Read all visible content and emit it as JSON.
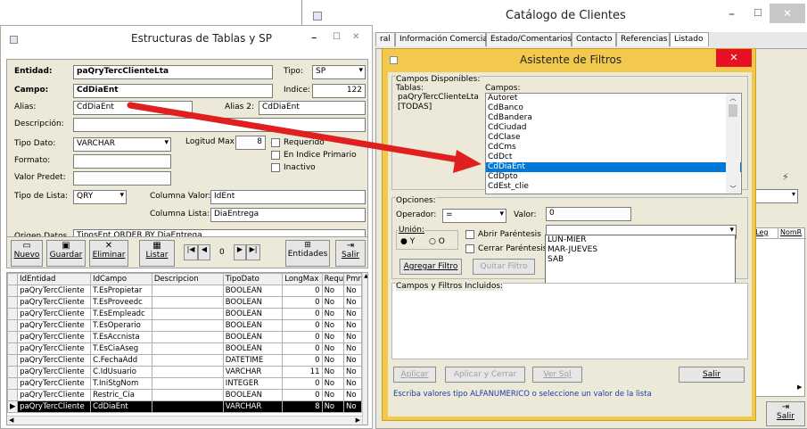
{
  "catalog": {
    "title": "Catálogo de Clientes",
    "tabs": [
      "ral",
      "Información Comercial",
      "Estado/Comentarios",
      "Contacto",
      "Referencias",
      "Listado"
    ],
    "grid_headers": [
      "pLeg",
      "NomR"
    ],
    "salir": "Salir"
  },
  "struct": {
    "title": "Estructuras de Tablas y SP",
    "entidad_label": "Entidad:",
    "entidad_value": "paQryTercClienteLta",
    "tipo_label": "Tipo:",
    "tipo_value": "SP",
    "campo_label": "Campo:",
    "campo_value": "CdDiaEnt",
    "indice_label": "Indice:",
    "indice_value": "122",
    "alias_label": "Alias:",
    "alias_value": "CdDiaEnt",
    "alias2_label": "Alias 2:",
    "alias2_value": "CdDiaEnt",
    "descripcion_label": "Descripción:",
    "tipodato_label": "Tipo Dato:",
    "tipodato_value": "VARCHAR",
    "longitud_label": "Logitud Max:",
    "longitud_value": "8",
    "requerido_label": "Requerido",
    "indice_primario_label": "En Indice Primario",
    "inactivo_label": "Inactivo",
    "formato_label": "Formato:",
    "valorpredet_label": "Valor Predet:",
    "tipolista_label": "Tipo de Lista:",
    "tipolista_value": "QRY",
    "colvalor_label": "Columna Valor:",
    "colvalor_value": "IdEnt",
    "collista_label": "Columna Lista:",
    "collista_value": "DiaEntrega",
    "origen_label": "Origen Datos",
    "origen_value": "TiposEnt ORDER BY DiaEntrega",
    "toolbar": {
      "nuevo": "Nuevo",
      "guardar": "Guardar",
      "eliminar": "Eliminar",
      "listar": "Listar",
      "nav_value": "0",
      "entidades": "Entidades",
      "salir": "Salir"
    },
    "grid_headers": [
      "IdEntidad",
      "IdCampo",
      "Descripcion",
      "TipoDato",
      "LongMax",
      "Requeri",
      "Pmry"
    ],
    "rows": [
      [
        "paQryTercCliente",
        "T.EsPropietar",
        "",
        "BOOLEAN",
        "0",
        "No",
        "No"
      ],
      [
        "paQryTercCliente",
        "T.EsProveedc",
        "",
        "BOOLEAN",
        "0",
        "No",
        "No"
      ],
      [
        "paQryTercCliente",
        "T.EsEmpleadc",
        "",
        "BOOLEAN",
        "0",
        "No",
        "No"
      ],
      [
        "paQryTercCliente",
        "T.EsOperario",
        "",
        "BOOLEAN",
        "0",
        "No",
        "No"
      ],
      [
        "paQryTercCliente",
        "T.EsAccnista",
        "",
        "BOOLEAN",
        "0",
        "No",
        "No"
      ],
      [
        "paQryTercCliente",
        "T.EsCiaAseg",
        "",
        "BOOLEAN",
        "0",
        "No",
        "No"
      ],
      [
        "paQryTercCliente",
        "C.FechaAdd",
        "",
        "DATETIME",
        "0",
        "No",
        "No"
      ],
      [
        "paQryTercCliente",
        "C.IdUsuario",
        "",
        "VARCHAR",
        "11",
        "No",
        "No"
      ],
      [
        "paQryTercCliente",
        "T.IniStgNom",
        "",
        "INTEGER",
        "0",
        "No",
        "No"
      ],
      [
        "paQryTercCliente",
        "Restric_Cia",
        "",
        "BOOLEAN",
        "0",
        "No",
        "No"
      ],
      [
        "paQryTercCliente",
        "CdDiaEnt",
        "",
        "VARCHAR",
        "8",
        "No",
        "No"
      ]
    ]
  },
  "filter": {
    "title": "Asistente de Filtros",
    "campos_disponibles": "Campos Disponibles:",
    "tablas_label": "Tablas:",
    "campos_label": "Campos:",
    "tablas": [
      "paQryTercClienteLta",
      "[TODAS]"
    ],
    "campos": [
      "Autoret",
      "CdBanco",
      "CdBandera",
      "CdCiudad",
      "CdClase",
      "CdCms",
      "CdDct",
      "CdDiaEnt",
      "CdDpto",
      "CdEst_clie"
    ],
    "selected_campo": "CdDiaEnt",
    "opciones_label": "Opciones:",
    "operador_label": "Operador:",
    "operador_value": "=",
    "valor_label": "Valor:",
    "valor_value": "0",
    "union_label": "Unión:",
    "union_y": "Y",
    "union_o": "O",
    "abrir": "Abrir Paréntesis",
    "cerrar": "Cerrar Paréntesis",
    "agregar": "Agregar Filtro",
    "quitar": "Quitar Filtro",
    "dropdown_options": [
      "LUN-MIER",
      "MAR-JUEVES",
      "SAB"
    ],
    "incluidos_label": "Campos y Filtros Incluidos:",
    "aplicar": "Aplicar",
    "aplicar_cerrar": "Aplicar y Cerrar",
    "ver_sql": "Ver Sql",
    "salir": "Salir",
    "hint": "Escriba valores tipo ALFANUMERICO o seleccione un valor de la lista"
  },
  "colors": {
    "accent": "#e81123",
    "filter_frame": "#f2c94c",
    "selection": "#0078d7",
    "arrow": "#e02020",
    "panel": "#ece9d8"
  }
}
